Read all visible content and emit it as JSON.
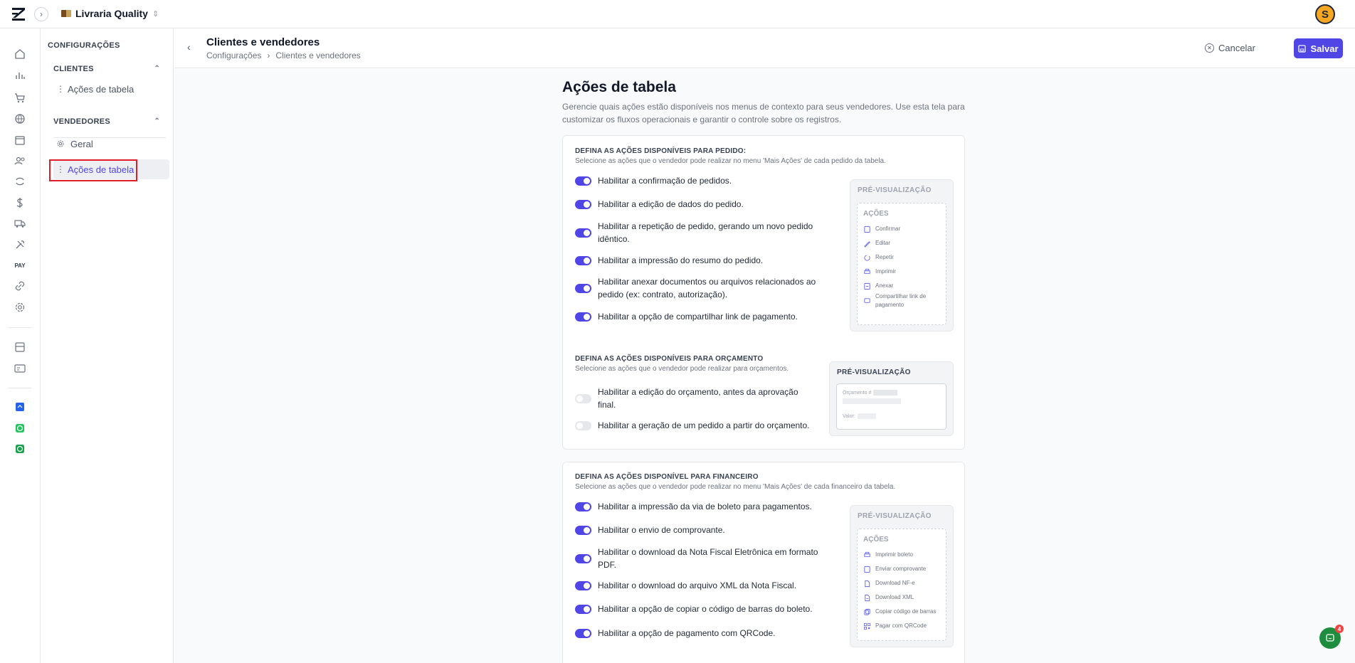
{
  "topbar": {
    "store_name": "Livraria Quality",
    "avatar_initial": "S"
  },
  "rail": {
    "icons": [
      "home-icon",
      "chart-icon",
      "cart-icon",
      "globe-icon",
      "box-icon",
      "users-icon",
      "exchange-icon",
      "dollar-icon",
      "truck-icon",
      "tools-icon",
      "pay-icon",
      "link-icon",
      "gear-icon",
      "panel-icon",
      "card-icon",
      "app-blue-icon",
      "whatsapp-icon",
      "whatsapp-icon-2"
    ],
    "pay_label": "PAY"
  },
  "sidebar": {
    "title": "CONFIGURAÇÕES",
    "clientes": {
      "heading": "CLIENTES",
      "items": [
        {
          "label": "Ações de tabela"
        }
      ]
    },
    "vendedores": {
      "heading": "VENDEDORES",
      "items": [
        {
          "label": "Geral"
        },
        {
          "label": "Ações de tabela"
        }
      ]
    }
  },
  "header": {
    "title": "Clientes e vendedores",
    "breadcrumb": [
      "Configurações",
      "Clientes e vendedores"
    ],
    "cancel_label": "Cancelar",
    "save_label": "Salvar"
  },
  "main": {
    "title": "Ações de tabela",
    "description_line1": "Gerencie quais ações estão disponíveis nos menus de contexto para seus vendedores. Use esta tela para",
    "description_line2": "customizar os fluxos operacionais e garantir o controle sobre os registros."
  },
  "pedido": {
    "title": "DEFINA AS AÇÕES DISPONÍVEIS PARA PEDIDO:",
    "subtitle": "Selecione as ações que o vendedor pode realizar no menu 'Mais Ações' de cada pedido da tabela.",
    "options": [
      {
        "label": "Habilitar a confirmação de pedidos.",
        "enabled": true
      },
      {
        "label": "Habilitar a edição de dados do pedido.",
        "enabled": true
      },
      {
        "label": "Habilitar a repetição de pedido, gerando um novo pedido idêntico.",
        "enabled": true
      },
      {
        "label": "Habilitar a impressão do resumo do pedido.",
        "enabled": true
      },
      {
        "label": "Habilitar anexar documentos ou arquivos relacionados ao pedido (ex: contrato, autorização).",
        "enabled": true
      },
      {
        "label": "Habilitar a opção de compartilhar link de pagamento.",
        "enabled": true
      }
    ],
    "preview": {
      "title": "PRÉ-VISUALIZAÇÃO",
      "heading": "AÇÕES",
      "items": [
        "Confirmar",
        "Editar",
        "Repetir",
        "Imprimir",
        "Anexar",
        "Compartilhar link de pagamento"
      ]
    }
  },
  "orcamento": {
    "title": "DEFINA AS AÇÕES DISPONÍVEIS PARA ORÇAMENTO",
    "subtitle": "Selecione as ações que o vendedor pode realizar para orçamentos.",
    "options": [
      {
        "label": "Habilitar a edição do orçamento, antes da aprovação final.",
        "enabled": false
      },
      {
        "label": "Habilitar a geração de um pedido a partir do orçamento.",
        "enabled": false
      }
    ],
    "preview": {
      "title": "PRÉ-VISUALIZAÇÃO",
      "orcamento_label": "Orçamento #",
      "valor_label": "Valor:"
    }
  },
  "financeiro": {
    "title": "DEFINA AS AÇÕES DISPONÍVEL PARA FINANCEIRO",
    "subtitle": "Selecione as ações que o vendedor pode realizar no menu 'Mais Ações' de cada financeiro da tabela.",
    "options": [
      {
        "label": "Habilitar a impressão da via de boleto para pagamentos.",
        "enabled": true
      },
      {
        "label": "Habilitar o envio de comprovante.",
        "enabled": true
      },
      {
        "label": "Habilitar o download da Nota Fiscal Eletrônica em formato PDF.",
        "enabled": true
      },
      {
        "label": "Habilitar o download do arquivo XML da Nota Fiscal.",
        "enabled": true
      },
      {
        "label": "Habilitar a opção de copiar o código de barras do boleto.",
        "enabled": true
      },
      {
        "label": "Habilitar a opção de pagamento com QRCode.",
        "enabled": true
      }
    ],
    "preview": {
      "title": "PRÉ-VISUALIZAÇÃO",
      "heading": "AÇÕES",
      "items": [
        "Imprimir boleto",
        "Enviar comprovante",
        "Download NF-e",
        "Download XML",
        "Copiar código de barras",
        "Pagar com QRCode"
      ]
    }
  },
  "chat": {
    "badge": "4"
  },
  "colors": {
    "accent": "#4f46e5",
    "highlight": "#e11d2a",
    "avatar": "#f5a623",
    "chat": "#1e8e3e"
  }
}
